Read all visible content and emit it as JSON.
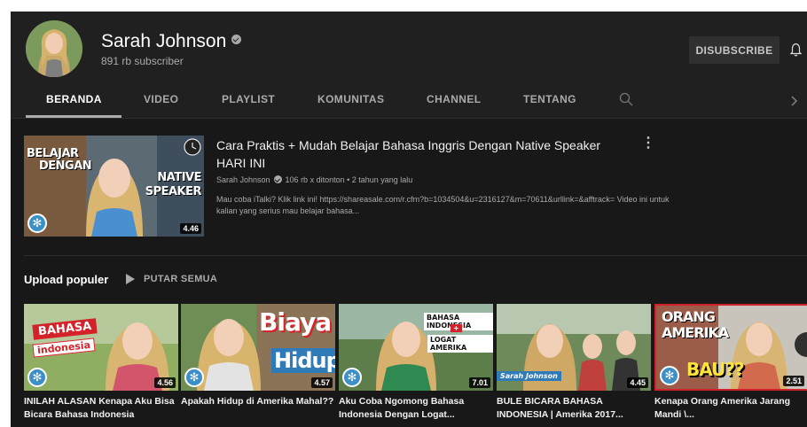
{
  "channel": {
    "name": "Sarah Johnson",
    "subscribers": "891 rb subscriber",
    "subscribe_label": "DISUBSCRIBE"
  },
  "tabs": [
    "BERANDA",
    "VIDEO",
    "PLAYLIST",
    "KOMUNITAS",
    "CHANNEL",
    "TENTANG"
  ],
  "icons": {
    "avatar": "avatar",
    "verified": "verified-check-icon",
    "bell": "bell-icon",
    "search": "search-icon",
    "next": "chevron-right-icon",
    "more": "more-vert-icon",
    "clock": "watch-later-icon",
    "play": "play-icon",
    "badge": "channel-logo-icon"
  },
  "featured": {
    "title": "Cara Praktis + Mudah Belajar Bahasa Inggris Dengan Native Speaker HARI INI",
    "channel": "Sarah Johnson",
    "stats": "106 rb x ditonton • 2 tahun yang lalu",
    "description": "Mau coba iTalki? Klik link ini! https://shareasale.com/r.cfm?b=1034504&u=2316127&m=70611&urllink=&afftrack= Video ini untuk kalian yang serius mau belajar bahasa...",
    "duration": "4.46",
    "overlay": {
      "left_top": "BELAJAR",
      "left_bottom": "DENGAN",
      "right_top": "NATIVE",
      "right_bottom": "SPEAKER"
    }
  },
  "shelf": {
    "title": "Upload populer",
    "play_all": "PUTAR SEMUA",
    "videos": [
      {
        "title": "INILAH ALASAN Kenapa Aku Bisa Bicara Bahasa Indonesia",
        "duration": "4.56",
        "overlay": [
          "BAHASA",
          "indonesia"
        ]
      },
      {
        "title": "Apakah Hidup di Amerika Mahal??",
        "duration": "4.57",
        "overlay": [
          "Biaya",
          "Hidup"
        ]
      },
      {
        "title": "Aku Coba Ngomong Bahasa Indonesia Dengan Logat...",
        "duration": "7.01",
        "overlay": [
          "BAHASA INDONESIA",
          "+",
          "LOGAT AMERIKA"
        ]
      },
      {
        "title": "BULE BICARA BAHASA INDONESIA | Amerika 2017...",
        "duration": "4.45",
        "overlay": [
          "Sarah Johnson"
        ]
      },
      {
        "title": "Kenapa Orang Amerika Jarang Mandi \\...",
        "duration": "2.51",
        "overlay": [
          "ORANG",
          "AMERIKA",
          "BAU??"
        ]
      }
    ]
  },
  "colors": {
    "bg": "#181818",
    "header": "#202020",
    "muted": "#aaaaaa",
    "badge": "#3c8fc7"
  }
}
